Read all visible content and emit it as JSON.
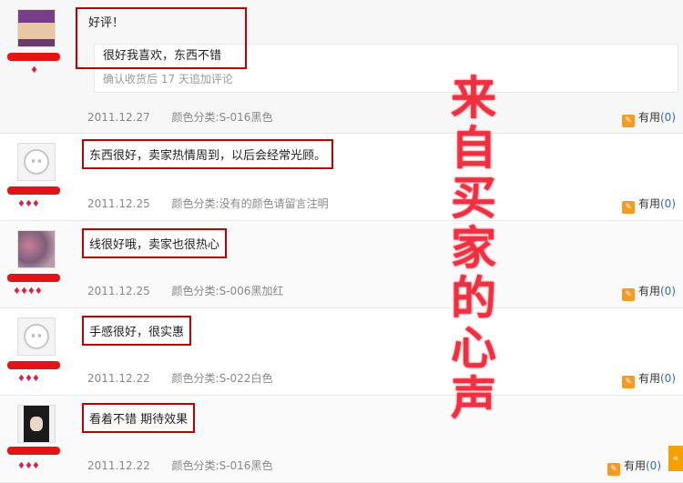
{
  "overlay_text": [
    "来",
    "自",
    "买",
    "家",
    "的",
    "心",
    "声"
  ],
  "useful_label": "有用",
  "color_label_prefix": "颜色分类:",
  "corner_glyph": "«",
  "reviews": [
    {
      "comment": "好评！",
      "append_text": "很好我喜欢，东西不错",
      "append_note": "确认收货后 17 天追加评论",
      "date": "2011.12.27",
      "color": "S-016黑色",
      "useful_count": "(0)",
      "rank": "♦",
      "username_tail": "."
    },
    {
      "comment": "东西很好，卖家热情周到，以后会经常光顾。",
      "date": "2011.12.25",
      "color": "没有的颜色请留言注明",
      "useful_count": "(0)",
      "rank": "♦♦♦",
      "username_tail": ""
    },
    {
      "comment": "线很好哦，卖家也很热心",
      "date": "2011.12.25",
      "color": "S-006黑加红",
      "useful_count": "(0)",
      "rank": "♦♦♦♦",
      "username_tail": ""
    },
    {
      "comment": "手感很好，很实惠",
      "date": "2011.12.22",
      "color": "S-022白色",
      "useful_count": "(0)",
      "rank": "♦♦♦",
      "username_tail": ""
    },
    {
      "comment": "看着不错 期待效果",
      "date": "2011.12.22",
      "color": "S-016黑色",
      "useful_count": "(0)",
      "rank": "♦♦♦",
      "username_tail": "."
    }
  ]
}
